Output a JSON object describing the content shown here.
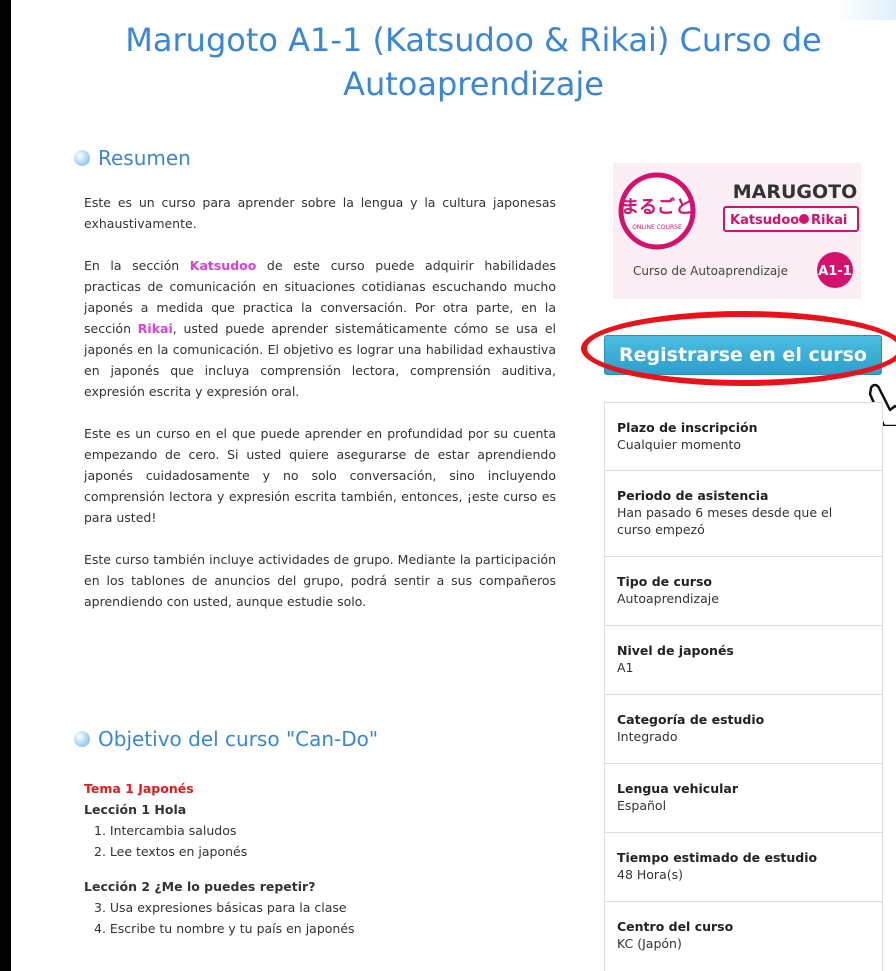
{
  "title": "Marugoto A1-1 (Katsudoo & Rikai) Curso de Autoaprendizaje",
  "summary": {
    "heading": "Resumen",
    "p1": "Este es un curso para aprender sobre la lengua y la cultura japonesas exhaustivamente.",
    "p2_a": "En la sección ",
    "katsudoo": "Katsudoo",
    "p2_b": " de este curso puede adquirir habilidades practicas de comunicación en situaciones cotidianas escuchando mucho japonés a medida que practica la conversación. Por otra parte, en la sección ",
    "rikai": "Rikai",
    "p2_c": ", usted puede aprender sistemáticamente cómo se usa el japonés en la comunicación. El objetivo es lograr una habilidad exhaustiva en japonés que incluya comprensión lectora, comprensión auditiva, expresión escrita y expresión oral.",
    "p3": "Este es un curso en el que puede aprender en profundidad  por su cuenta empezando de cero. Si usted quiere asegurarse de estar aprendiendo japonés cuidadosamente y no solo conversación, sino incluyendo comprensión lectora y expresión escrita también, entonces, ¡este curso es para usted!",
    "p4": "Este curso también incluye actividades de grupo. Mediante la participación en los tablones de anuncios del grupo, podrá sentir a sus compañeros aprendiendo con usted, aunque estudie solo."
  },
  "cando": {
    "heading": "Objetivo del curso \"Can-Do\"",
    "theme": "Tema 1  Japonés",
    "lesson1": "Lección 1  Hola",
    "l1_items": [
      "1. Intercambia saludos",
      "2. Lee textos en japonés"
    ],
    "lesson2": "Lección 2  ¿Me lo puedes repetir?",
    "l2_items": [
      "3. Usa expresiones básicas para la clase",
      "4. Escribe tu nombre y tu país en japonés"
    ]
  },
  "logo": {
    "brand": "MARUGOTO",
    "sub": "Katsudoo",
    "sub2": "Rikai",
    "course": "Curso de Autoaprendizaje",
    "level": "A1-1",
    "badge_jp": "まるごと",
    "badge_small": "ONLINE COURSE"
  },
  "register_button": "Registrarse en el curso",
  "info": [
    {
      "label": "Plazo de inscripción",
      "value": "Cualquier momento"
    },
    {
      "label": "Periodo de asistencia",
      "value": "Han pasado 6 meses desde que el curso empezó"
    },
    {
      "label": "Tipo de curso",
      "value": "Autoaprendizaje"
    },
    {
      "label": "Nivel de japonés",
      "value": "A1"
    },
    {
      "label": "Categoría de estudio",
      "value": "Integrado"
    },
    {
      "label": "Lengua vehicular",
      "value": "Español"
    },
    {
      "label": "Tiempo estimado de estudio",
      "value": "48 Hora(s)"
    },
    {
      "label": "Centro del curso",
      "value": "KC (Japón)"
    }
  ],
  "colors": {
    "accent_blue": "#3a86d8",
    "keyword_pink": "#d744d0",
    "theme_red": "#e21a1a",
    "button": "#2c9fcd",
    "highlight": "#e8121b"
  }
}
